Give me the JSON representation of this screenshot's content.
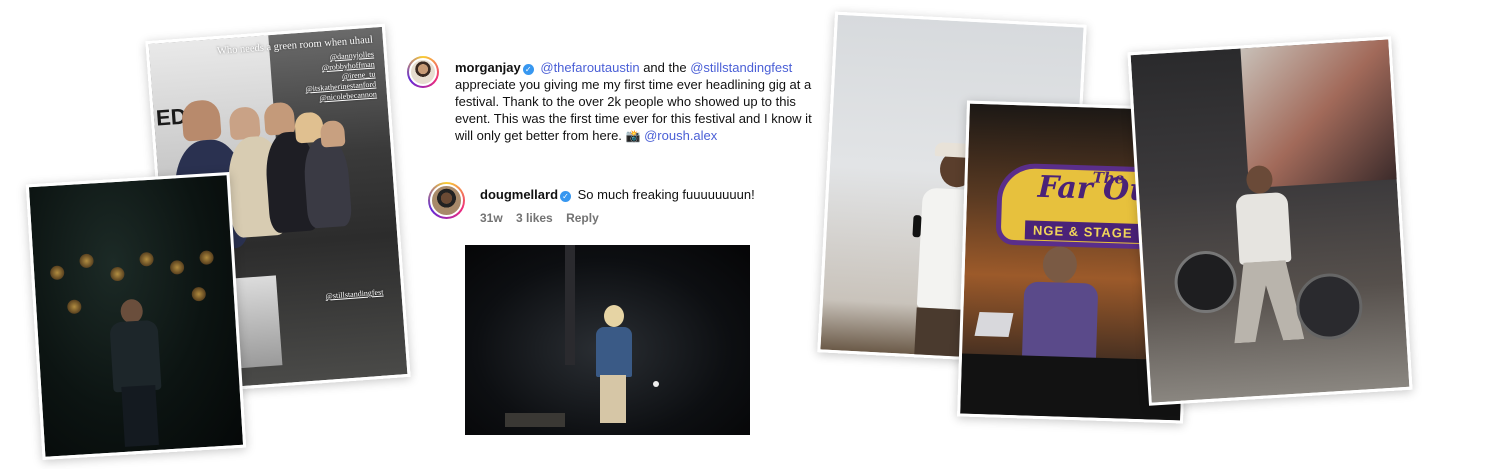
{
  "story": {
    "caption": "Who needs a green room when uhaul",
    "tags": [
      "@dannyjolles",
      "@robbyhoffman",
      "@irene_tu",
      "@itskatherinestanford",
      "@nicolebecannon"
    ],
    "bottom_tag": "@stillstandingfest",
    "truck_mark": "ED"
  },
  "main_comment": {
    "username": "morganjay",
    "mention1": "@thefaroutaustin",
    "mid1": " and the ",
    "mention2": "@stillstandingfest",
    "body": " appreciate you giving me my first time ever headlining gig at a festival. Thank to the over 2k people who showed up to this event. This was the first time ever for this festival and I know it will only get better from here. ",
    "emoji": "📸",
    "mention3": "@roush.alex"
  },
  "reply": {
    "username": "dougmellard",
    "body": "So much freaking fuuuuuuuun!",
    "time": "31w",
    "likes": "3 likes",
    "reply_label": "Reply"
  },
  "farout_sign": {
    "the": "The",
    "title": "Far Out",
    "subtitle": "NGE & STAGE"
  },
  "icons": {
    "verified": "verified-badge-icon",
    "camera": "camera-emoji-icon"
  },
  "colors": {
    "verified_blue": "#3797f0",
    "mention_blue": "#4a5fd6",
    "meta_gray": "#737373",
    "sign_yellow": "#e7c13d",
    "sign_purple": "#4a2278"
  }
}
